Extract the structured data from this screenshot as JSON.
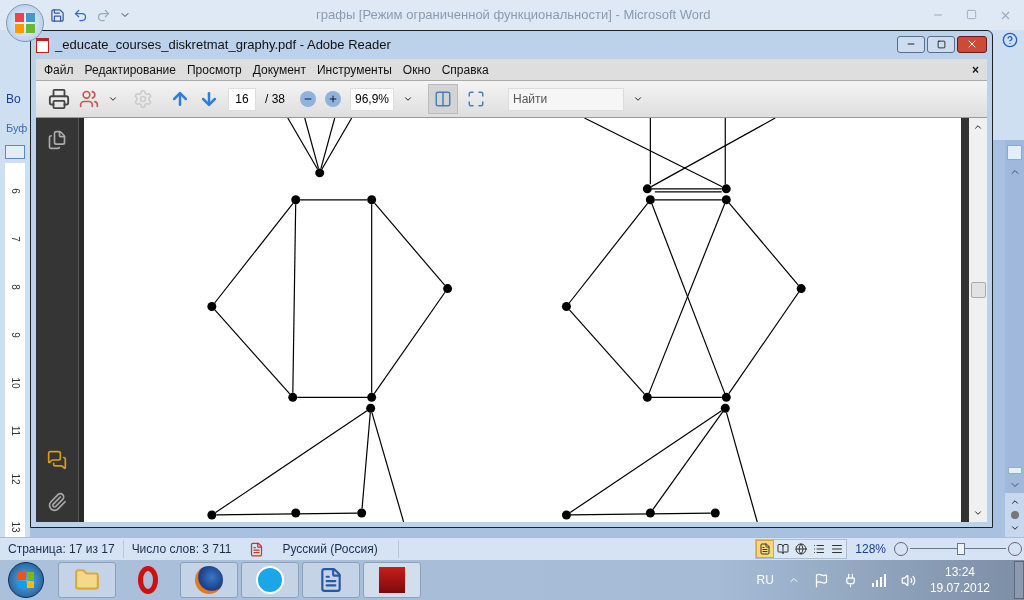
{
  "word": {
    "title": "графы [Режим ограниченной функциональности] - Microsoft Word",
    "ribbon_texts": [
      "Во",
      "Буф"
    ],
    "ruler": [
      "6",
      "7",
      "8",
      "9",
      "10",
      "11",
      "12",
      "13"
    ],
    "status_bar": {
      "page": "Страница: 17 из 17",
      "words": "Число слов: 3 711",
      "language": "Русский (Россия)",
      "zoom": "128%",
      "zoom_slider": {
        "level": 0.53
      },
      "views": [
        {
          "selected": true
        },
        {
          "selected": false
        },
        {
          "selected": false
        },
        {
          "selected": false
        },
        {
          "selected": false
        }
      ]
    }
  },
  "reader": {
    "title": "_educate_courses_diskretmat_graphy.pdf - Adobe Reader",
    "menu": [
      "Файл",
      "Редактирование",
      "Просмотр",
      "Документ",
      "Инструменты",
      "Окно",
      "Справка"
    ],
    "close_doc": "×",
    "page_current": "16",
    "page_total": "/ 38",
    "zoom": "96,9%",
    "search": {
      "placeholder": "Найти"
    }
  },
  "taskbar": {
    "language": "RU",
    "time": "13:24",
    "date": "19.07.2012"
  }
}
